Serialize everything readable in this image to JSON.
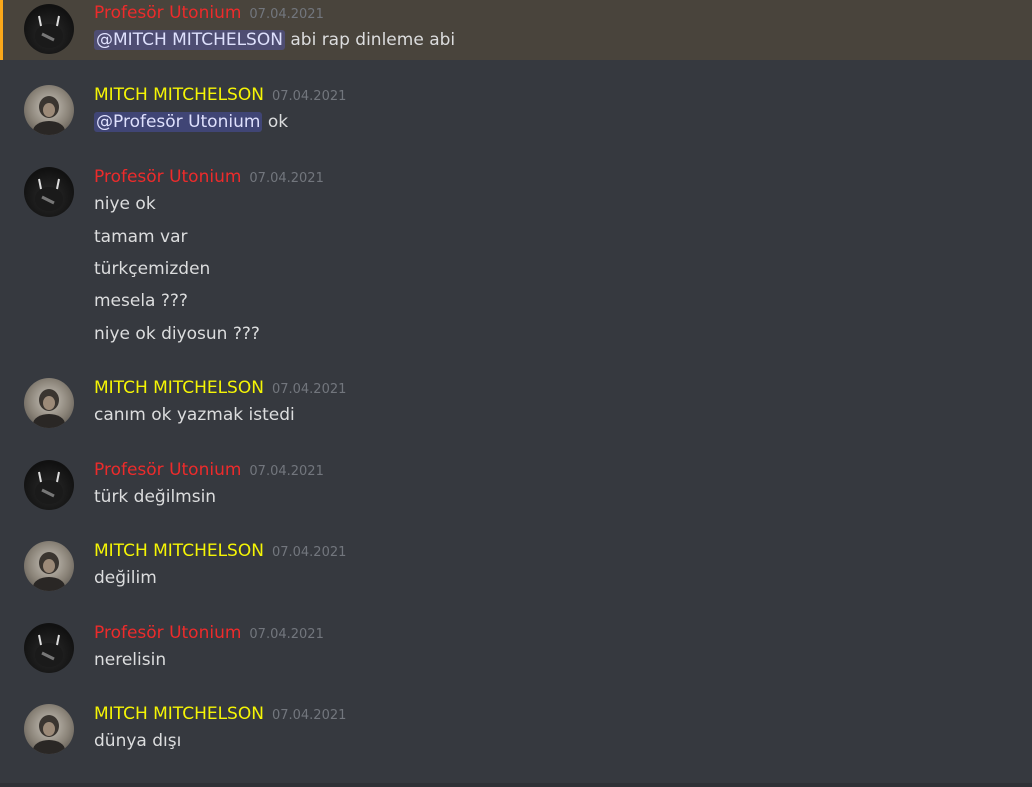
{
  "messages": [
    {
      "user": "Profesör Utonium",
      "time": "07.04.2021",
      "mention": "@MITCH MITCHELSON",
      "text": "abi rap dinleme abi"
    },
    {
      "user": "MITCH MITCHELSON",
      "time": "07.04.2021",
      "mention": "@Profesör Utonium",
      "text": "ok"
    },
    {
      "user": "Profesör Utonium",
      "time": "07.04.2021",
      "lines": [
        "niye ok",
        "tamam var",
        "türkçemizden",
        "mesela ???",
        "niye ok diyosun ???"
      ]
    },
    {
      "user": "MITCH MITCHELSON",
      "time": "07.04.2021",
      "lines": [
        "canım ok yazmak istedi"
      ]
    },
    {
      "user": "Profesör Utonium",
      "time": "07.04.2021",
      "lines": [
        "türk değilmsin"
      ]
    },
    {
      "user": "MITCH MITCHELSON",
      "time": "07.04.2021",
      "lines": [
        "değilim"
      ]
    },
    {
      "user": "Profesör Utonium",
      "time": "07.04.2021",
      "lines": [
        "nerelisin"
      ]
    },
    {
      "user": "MITCH MITCHELSON",
      "time": "07.04.2021",
      "lines": [
        "dünya dışı"
      ]
    }
  ],
  "colors": {
    "background": "#36393f",
    "prof_name": "#ed2b2b",
    "mitch_name": "#f5f505",
    "highlight_bg": "#49443c",
    "highlight_border": "#faa81a",
    "mention_bg": "#414675"
  }
}
